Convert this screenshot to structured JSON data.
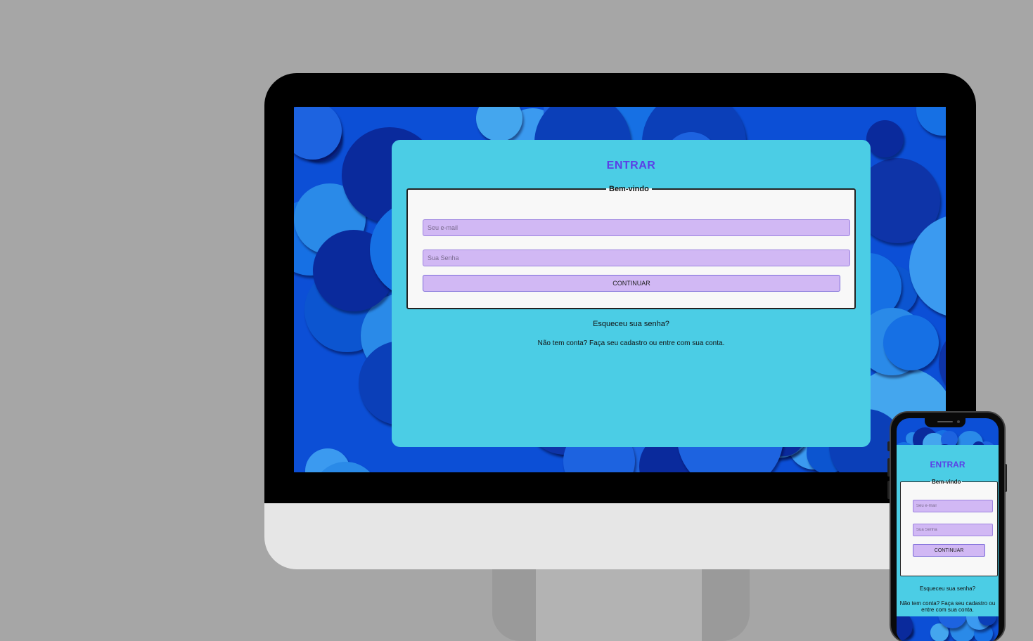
{
  "desktop": {
    "title": "ENTRAR",
    "fieldset_legend": "Bem-vindo",
    "email_placeholder": "Seu e-mail",
    "password_placeholder": "Sua Senha",
    "continue_label": "CONTINUAR",
    "forgot_link": "Esqueceu sua senha?",
    "signup_text": "Não tem conta? Faça seu cadastro ou entre com sua conta."
  },
  "mobile": {
    "title": "ENTRAR",
    "fieldset_legend": "Bem-vindo",
    "email_placeholder": "Seu e-mail",
    "password_placeholder": "Sua Senha",
    "continue_label": "CONTINUAR",
    "forgot_link": "Esqueceu sua senha?",
    "signup_text": "Não tem conta? Faça seu cadastro ou entre com sua conta."
  },
  "colors": {
    "page_background": "#a6a6a6",
    "card_background": "#4bcde5",
    "title_color": "#5b3fe6",
    "input_background": "#d1b8f4",
    "bubble_palette": [
      "#0a2a9c",
      "#0b3fb8",
      "#0c55d0",
      "#1670e4",
      "#2a8ae8",
      "#44a6ee",
      "#1d63e0",
      "#0e34a8",
      "#3b9af0"
    ]
  }
}
